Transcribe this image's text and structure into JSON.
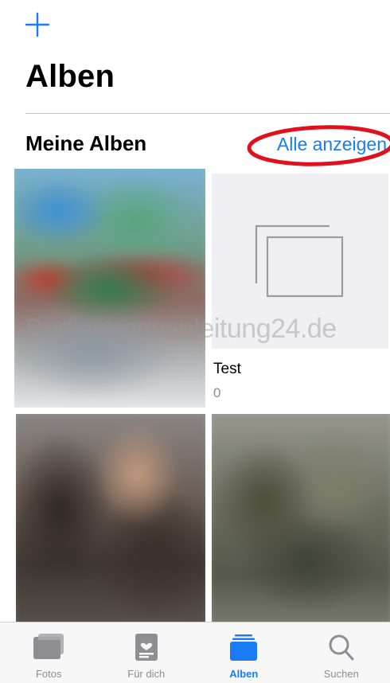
{
  "colors": {
    "accent": "#1a7cf5",
    "tab_inactive": "#8e8e93",
    "highlight_ring": "#e0101c"
  },
  "header": {
    "add_icon": "plus-icon",
    "title": "Alben"
  },
  "section": {
    "title": "Meine Alben",
    "see_all": "Alle anzeigen"
  },
  "albums": [
    {
      "name": "Test",
      "count": "0",
      "thumbnail": "empty-album-icon"
    }
  ],
  "watermark": "Bedienungsanleitung24.de",
  "tabbar": {
    "tabs": [
      {
        "label": "Fotos",
        "icon": "photos-icon",
        "active": false
      },
      {
        "label": "Für dich",
        "icon": "for-you-icon",
        "active": false
      },
      {
        "label": "Alben",
        "icon": "albums-icon",
        "active": true
      },
      {
        "label": "Suchen",
        "icon": "search-icon",
        "active": false
      }
    ]
  }
}
